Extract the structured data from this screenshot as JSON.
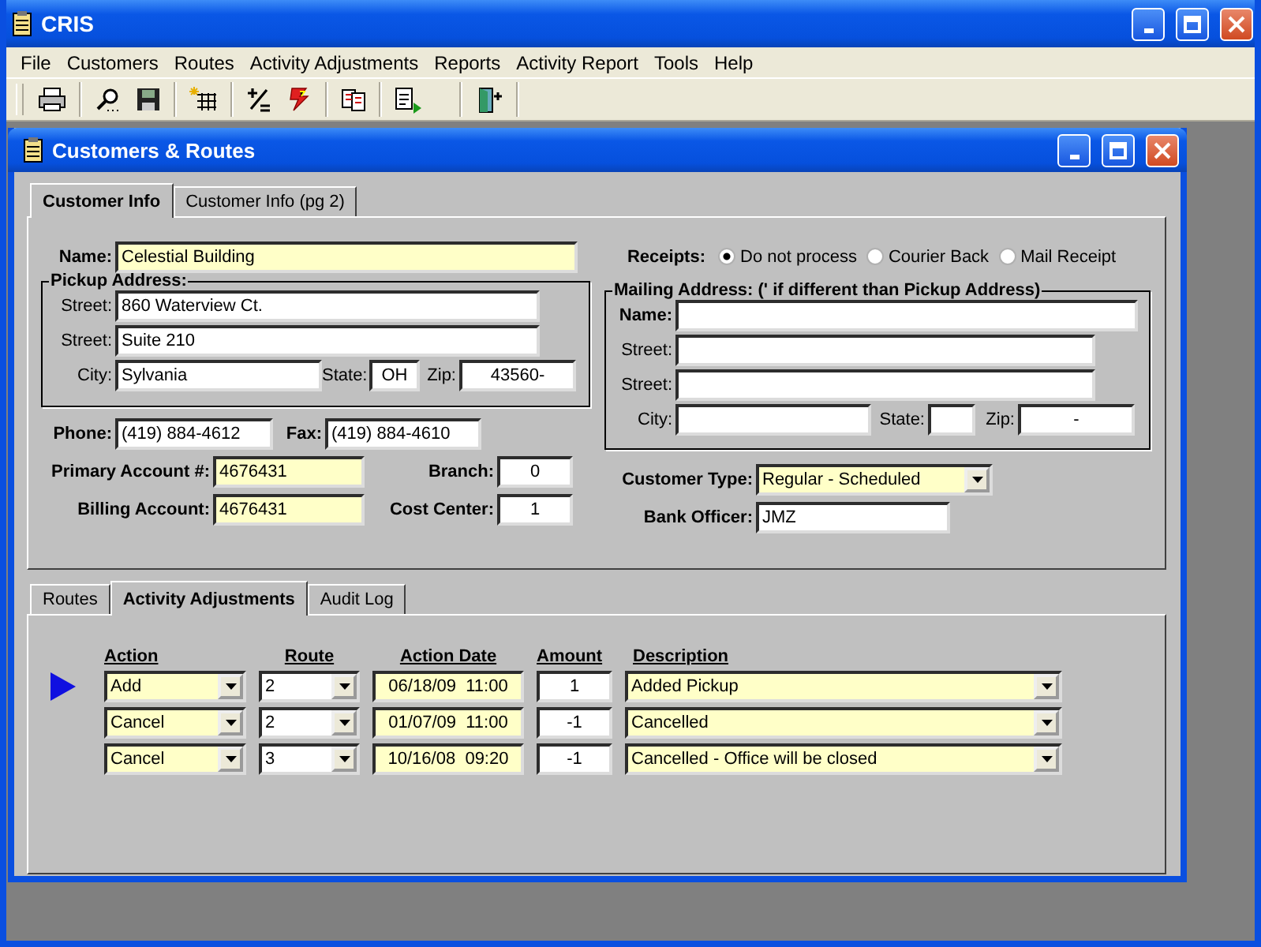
{
  "window": {
    "title": "CRIS"
  },
  "menu": [
    {
      "label": "File"
    },
    {
      "label": "Customers"
    },
    {
      "label": "Routes"
    },
    {
      "label": "Activity Adjustments"
    },
    {
      "label": "Reports"
    },
    {
      "label": "Activity Report"
    },
    {
      "label": "Tools"
    },
    {
      "label": "Help"
    }
  ],
  "child_window": {
    "title": "Customers & Routes"
  },
  "top_tabs": [
    {
      "label": "Customer Info",
      "selected": true
    },
    {
      "label": "Customer Info (pg 2)",
      "selected": false
    }
  ],
  "customer": {
    "name": {
      "label": "Name:",
      "value": "Celestial Building"
    },
    "pickup_address": {
      "title": "Pickup Address:",
      "street_1": {
        "label": "Street:",
        "value": "860 Waterview Ct."
      },
      "street_2": {
        "label": "Street:",
        "value": "Suite 210"
      },
      "city": {
        "label": "City:",
        "value": "Sylvania"
      },
      "state": {
        "label": "State:",
        "value": "OH"
      },
      "zip": {
        "label": "Zip:",
        "value": "43560-"
      }
    },
    "phone": {
      "label": "Phone:",
      "value": "(419) 884-4612"
    },
    "fax": {
      "label": "Fax:",
      "value": "(419) 884-4610"
    },
    "primary_account": {
      "label": "Primary Account #:",
      "value": "4676431"
    },
    "branch": {
      "label": "Branch:",
      "value": "0"
    },
    "billing_account": {
      "label": "Billing Account:",
      "value": "4676431"
    },
    "cost_center": {
      "label": "Cost Center:",
      "value": "1"
    },
    "receipts": {
      "label": "Receipts:",
      "options": [
        {
          "label": "Do not process",
          "selected": true
        },
        {
          "label": "Courier Back",
          "selected": false
        },
        {
          "label": "Mail Receipt",
          "selected": false
        }
      ]
    },
    "mailing_address": {
      "title": "Mailing Address:  (' if different than Pickup Address)",
      "name": {
        "label": "Name:"
      },
      "street_1": {
        "label": "Street:"
      },
      "street_2": {
        "label": "Street:"
      },
      "city": {
        "label": "City:"
      },
      "state": {
        "label": "State:"
      },
      "zip": {
        "label": "Zip:",
        "value": "-"
      }
    },
    "customer_type": {
      "label": "Customer Type:",
      "value": "Regular - Scheduled"
    },
    "bank_officer": {
      "label": "Bank Officer:",
      "value": "JMZ"
    }
  },
  "bottom_tabs": [
    {
      "label": "Routes",
      "selected": false
    },
    {
      "label": "Activity Adjustments",
      "selected": true
    },
    {
      "label": "Audit Log",
      "selected": false
    }
  ],
  "adjustments": {
    "columns": [
      "Action",
      "Route",
      "Action Date",
      "Amount",
      "Description"
    ],
    "rows": [
      {
        "selected": true,
        "action": "Add",
        "route": "2",
        "action_date": "06/18/09  11:00",
        "amount": "1",
        "description": "Added Pickup"
      },
      {
        "selected": false,
        "action": "Cancel",
        "route": "2",
        "action_date": "01/07/09  11:00",
        "amount": "-1",
        "description": "Cancelled"
      },
      {
        "selected": false,
        "action": "Cancel",
        "route": "3",
        "action_date": "10/16/08  09:20",
        "amount": "-1",
        "description": "Cancelled - Office will be closed"
      }
    ]
  }
}
